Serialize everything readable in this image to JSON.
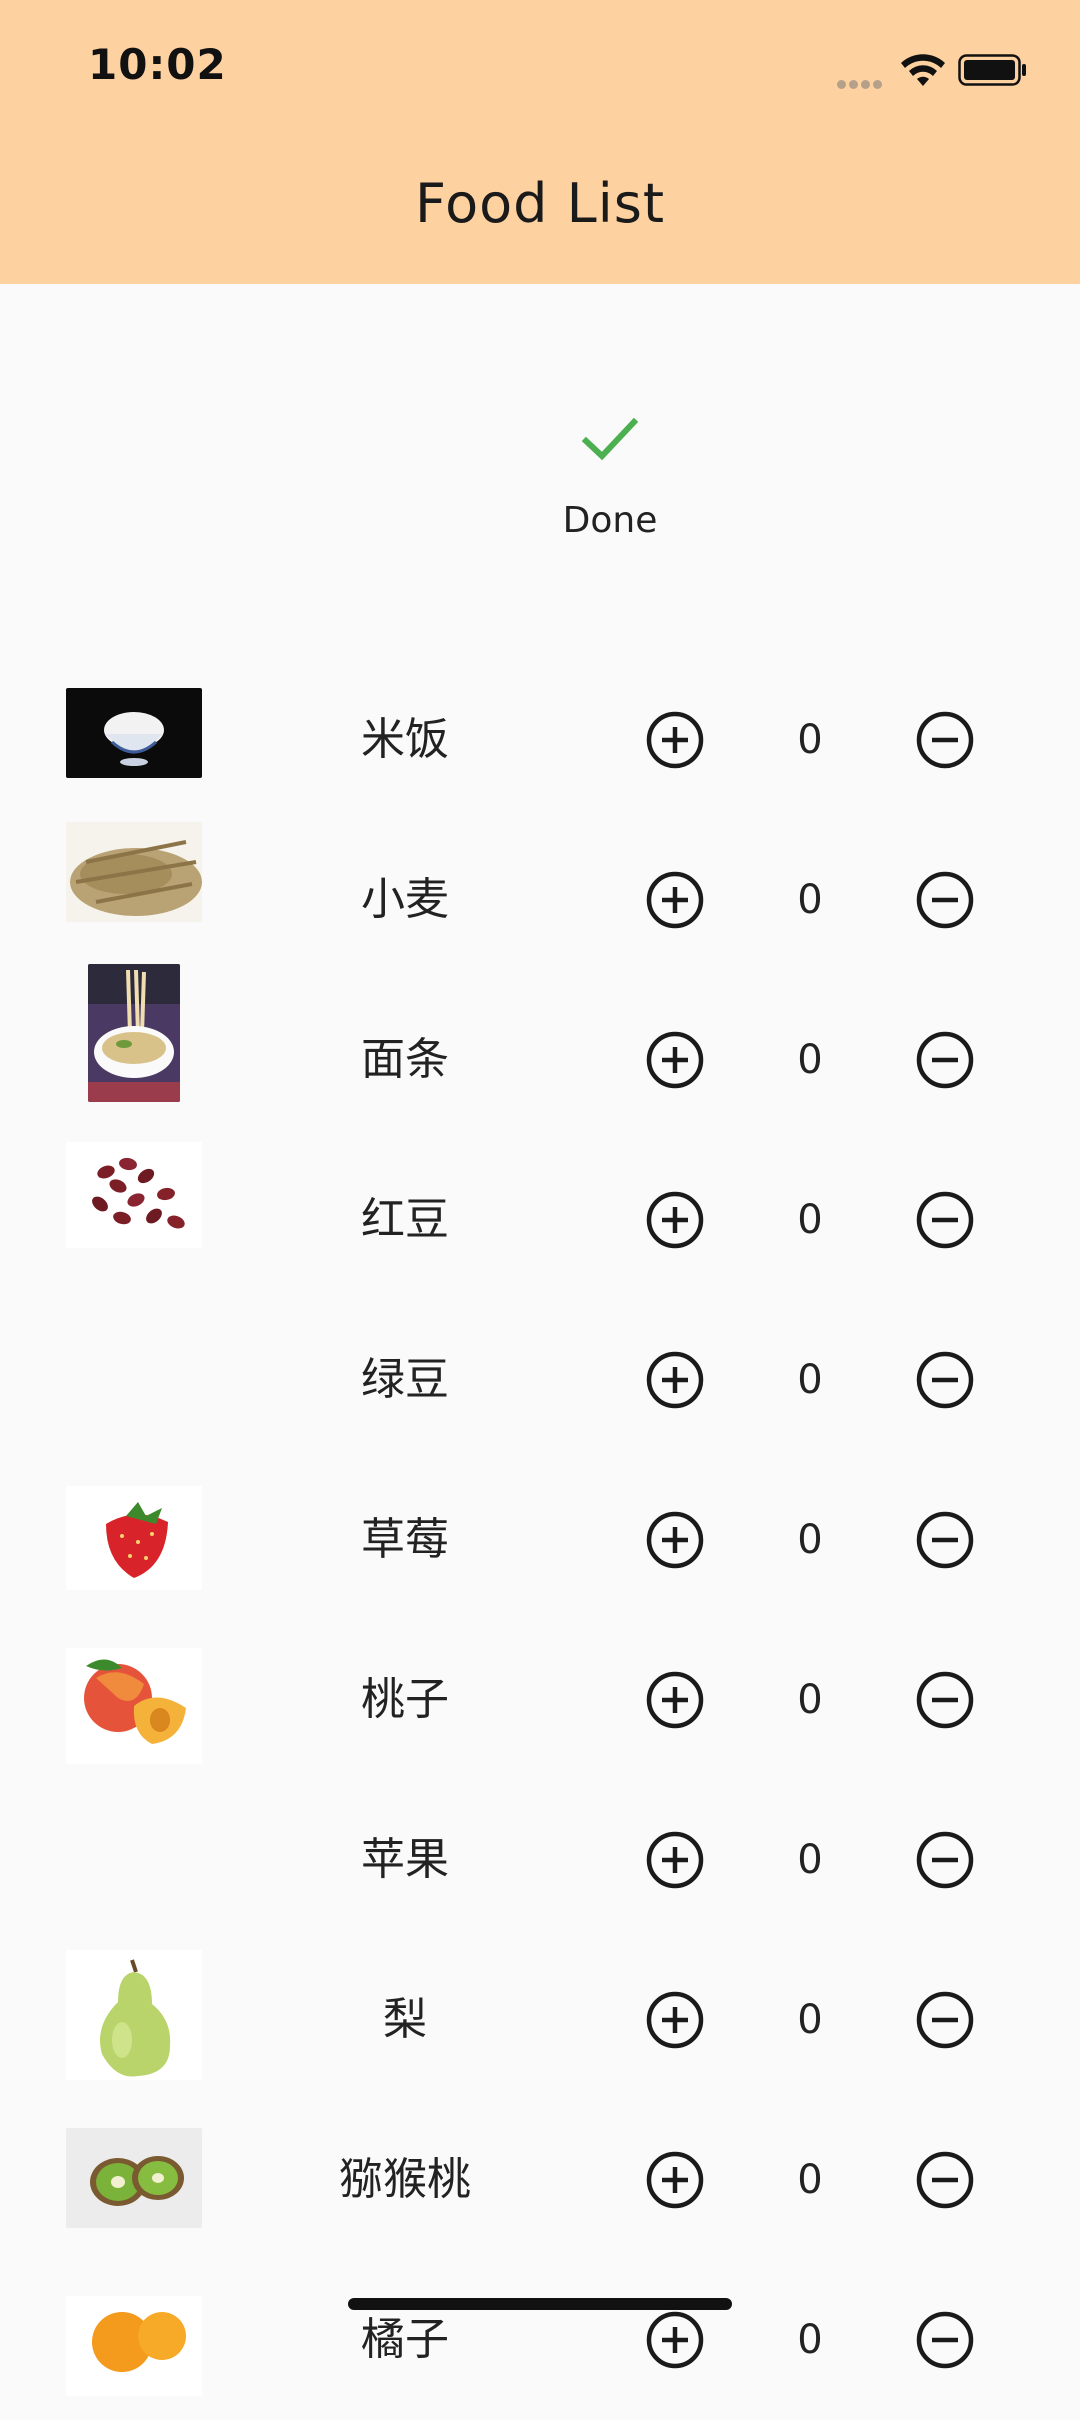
{
  "status_bar": {
    "time": "10:02"
  },
  "header": {
    "title": "Food List",
    "background": "#fed1a1"
  },
  "done": {
    "label": "Done",
    "icon": "checkmark-icon",
    "color": "#4caf50"
  },
  "foods": [
    {
      "name": "米饭",
      "quantity": "0",
      "image": "rice-bowl-photo"
    },
    {
      "name": "小麦",
      "quantity": "0",
      "image": "wheat-grain-photo"
    },
    {
      "name": "面条",
      "quantity": "0",
      "image": "noodle-bowl-photo"
    },
    {
      "name": "红豆",
      "quantity": "0",
      "image": "red-bean-photo"
    },
    {
      "name": "绿豆",
      "quantity": "0",
      "image": ""
    },
    {
      "name": "草莓",
      "quantity": "0",
      "image": "strawberry-photo"
    },
    {
      "name": "桃子",
      "quantity": "0",
      "image": "peach-photo"
    },
    {
      "name": "苹果",
      "quantity": "0",
      "image": ""
    },
    {
      "name": "梨",
      "quantity": "0",
      "image": "pear-photo"
    },
    {
      "name": "猕猴桃",
      "quantity": "0",
      "image": "kiwi-photo"
    },
    {
      "name": "橘子",
      "quantity": "0",
      "image": "orange-photo"
    }
  ],
  "controls": {
    "add_icon": "plus-circle-icon",
    "remove_icon": "minus-circle-icon"
  }
}
